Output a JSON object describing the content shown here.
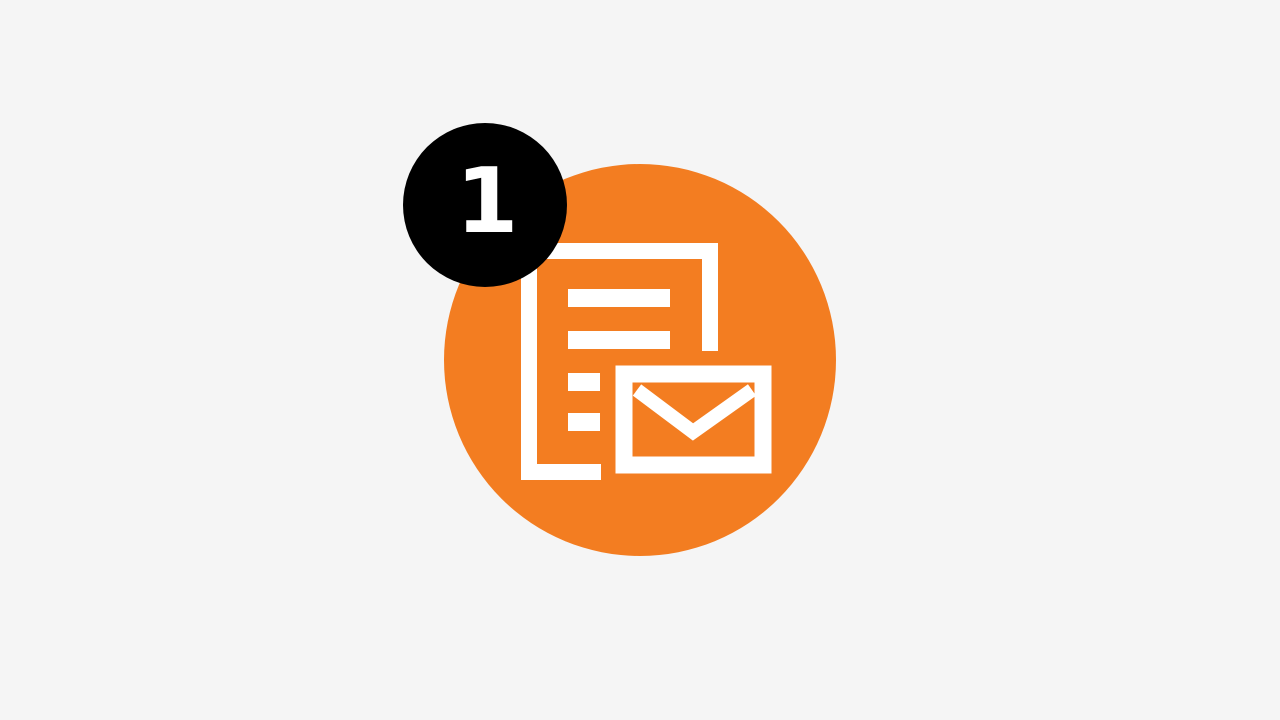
{
  "step": {
    "number": "1"
  },
  "icon": {
    "name": "document-envelope-icon",
    "background_color": "#f37d21",
    "foreground_color": "#ffffff"
  },
  "badge": {
    "background_color": "#000000",
    "text_color": "#ffffff"
  },
  "page": {
    "background_color": "#f5f5f5"
  }
}
